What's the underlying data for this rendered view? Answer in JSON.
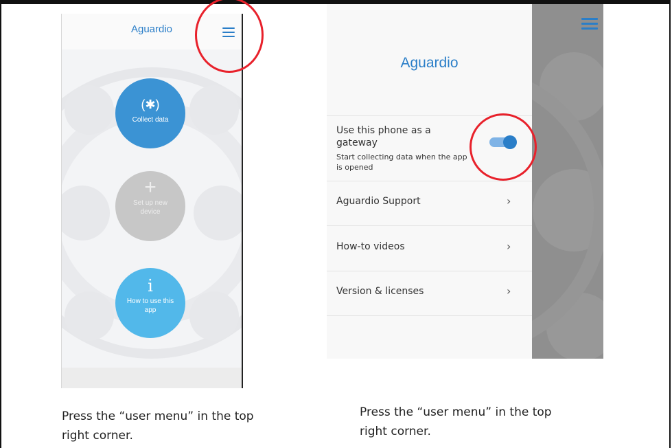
{
  "left_screen": {
    "logo": "Aguardio",
    "buttons": [
      {
        "icon": "bluetooth-icon",
        "glyph": "(✱)",
        "label": "Collect data"
      },
      {
        "icon": "plus-icon",
        "glyph": "+",
        "label": "Set up new device"
      },
      {
        "icon": "info-icon",
        "glyph": "i",
        "label": "How to use this app"
      }
    ]
  },
  "right_screen": {
    "logo": "Aguardio",
    "gateway": {
      "title": "Use this phone as a gateway",
      "subtitle": "Start collecting data when the app is opened",
      "enabled": true
    },
    "menu_items": [
      {
        "label": "Aguardio Support",
        "chevron": "›"
      },
      {
        "label": "How-to videos",
        "chevron": "›"
      },
      {
        "label": "Version & licenses",
        "chevron": "›"
      }
    ]
  },
  "captions": {
    "left": "Press the “user menu” in the top right corner.",
    "right": "Press the “user menu” in the top right corner."
  },
  "colors": {
    "brand_blue": "#2a7ec8",
    "collect_blue": "#3b93d4",
    "howto_blue": "#52b8ea",
    "annotation_red": "#e8212b"
  }
}
